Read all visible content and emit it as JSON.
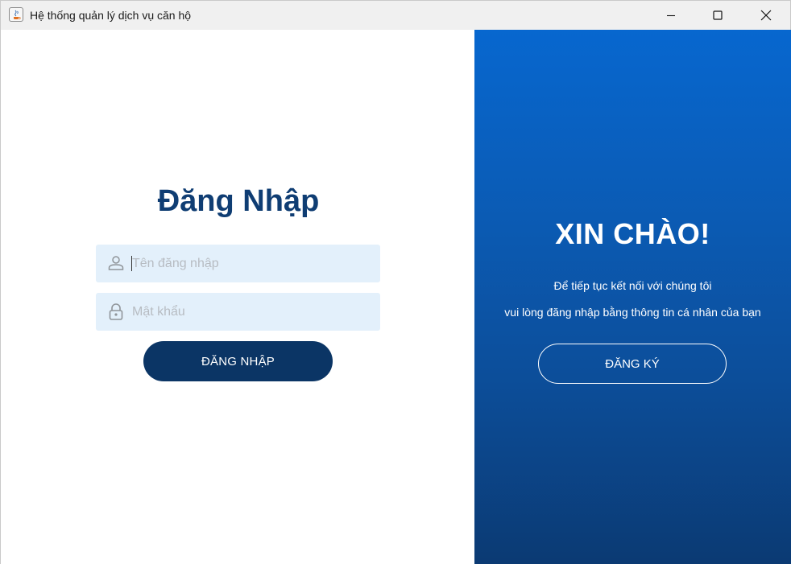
{
  "window": {
    "title": "Hệ thống quản lý dịch vụ căn hộ",
    "icons": {
      "app": "java-app-icon",
      "minimize": "minimize-icon",
      "maximize": "maximize-icon",
      "close": "close-icon"
    }
  },
  "login": {
    "title": "Đăng Nhập",
    "username": {
      "placeholder": "Tên đăng nhập",
      "value": "",
      "icon": "user-icon"
    },
    "password": {
      "placeholder": "Mật khẩu",
      "value": "",
      "icon": "lock-icon"
    },
    "submit_label": "ĐĂNG NHẬP"
  },
  "welcome": {
    "heading": "XIN CHÀO!",
    "line1": "Để tiếp tục kết nối với chúng tôi",
    "line2": "vui lòng đăng nhập bằng thông tin cá nhân của bạn",
    "register_label": "ĐĂNG KÝ"
  },
  "colors": {
    "title_text": "#0f3d73",
    "field_bg": "#e3f0fb",
    "login_button": "#0b3565",
    "panel_top": "#0767cf",
    "panel_bottom": "#0b3a73"
  }
}
